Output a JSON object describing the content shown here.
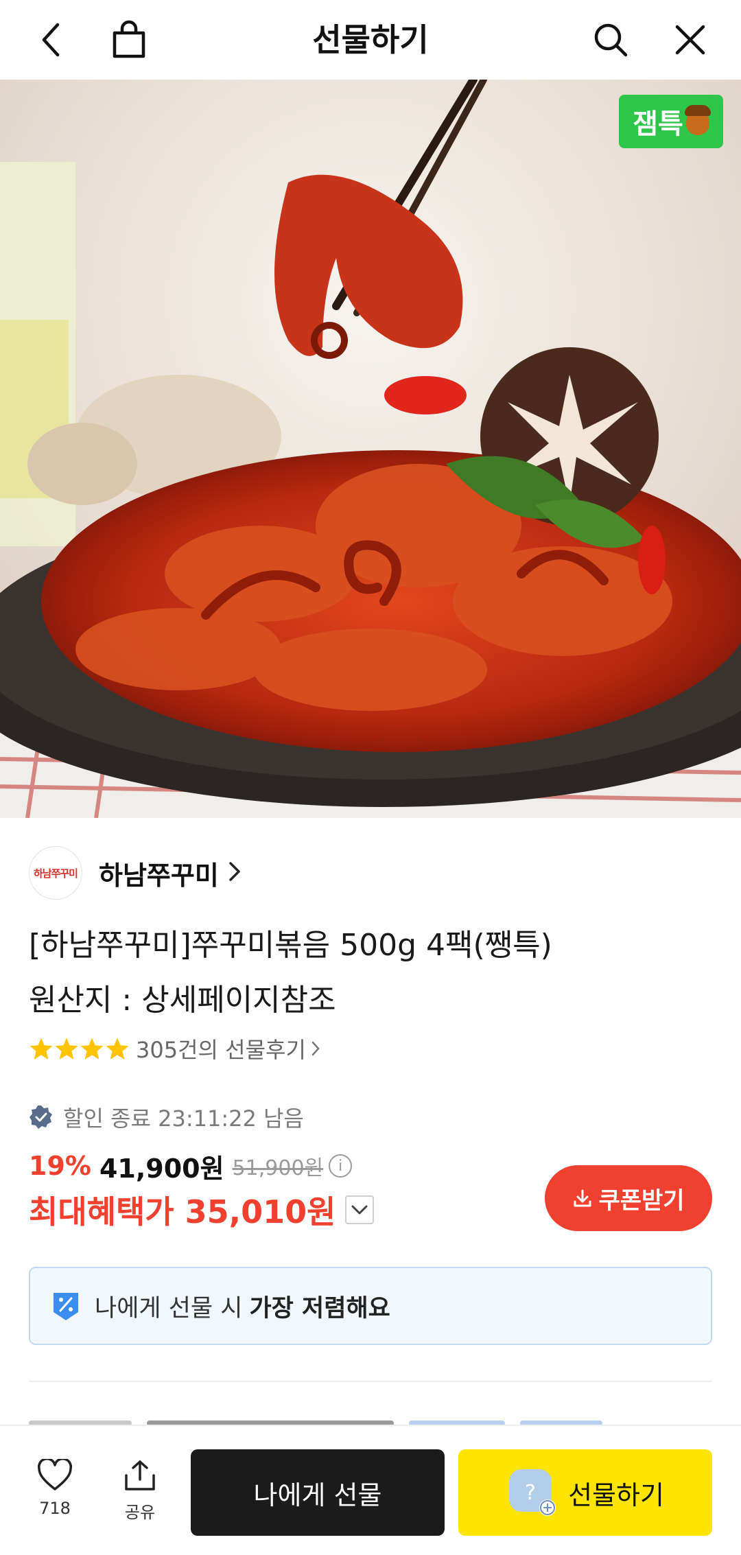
{
  "header": {
    "title": "선물하기"
  },
  "hero": {
    "badge_label": "잼특",
    "image_alt": "쭈꾸미볶음"
  },
  "store": {
    "logo_text": "하남쭈꾸미",
    "name": "하남쭈꾸미"
  },
  "product": {
    "title_line1": "[하남쭈꾸미]쭈꾸미볶음 500g 4팩(쨍특)",
    "title_line2": "원산지 : 상세페이지참조",
    "rating_stars": 4,
    "review_label": "305건의 선물후기"
  },
  "sale": {
    "timer_label": "할인 종료 23:11:22 남음",
    "discount_rate": "19%",
    "price": "41,900원",
    "original_price": "51,900원",
    "info_glyph": "i",
    "max_benefit_label": "최대혜택가 35,010원",
    "coupon_label": "쿠폰받기"
  },
  "benefit_banner": {
    "text_prefix": "나에게 선물 시",
    "text_bold": "가장 저렴해요"
  },
  "bottom_bar": {
    "like_count": "718",
    "share_label": "공유",
    "self_gift_label": "나에게 선물",
    "gift_label": "선물하기",
    "gift_icon_glyph": "?"
  },
  "colors": {
    "accent_red": "#f0402f",
    "kakao_yellow": "#fee500",
    "badge_green": "#2fc54a"
  }
}
